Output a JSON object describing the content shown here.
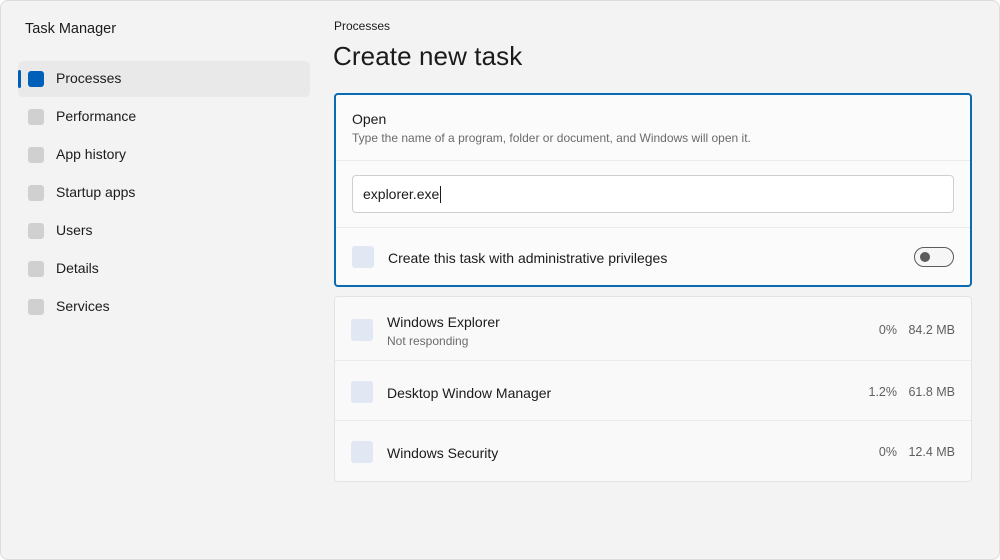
{
  "app": {
    "title": "Task Manager"
  },
  "sidebar": {
    "items": [
      {
        "label": "Processes",
        "icon": "processes-icon",
        "active": true
      },
      {
        "label": "Performance",
        "icon": "performance-icon",
        "active": false
      },
      {
        "label": "App history",
        "icon": "app-history-icon",
        "active": false
      },
      {
        "label": "Startup apps",
        "icon": "startup-apps-icon",
        "active": false
      },
      {
        "label": "Users",
        "icon": "users-icon",
        "active": false
      },
      {
        "label": "Details",
        "icon": "details-icon",
        "active": false
      },
      {
        "label": "Services",
        "icon": "services-icon",
        "active": false
      }
    ]
  },
  "main": {
    "breadcrumb": "Processes",
    "title": "Create new task"
  },
  "dialog": {
    "title": "Open",
    "description": "Type the name of a program, folder or document, and Windows will open it.",
    "input_value": "explorer.exe",
    "admin_label": "Create this task with administrative privileges",
    "admin_toggle_on": false
  },
  "processes": [
    {
      "name": "Windows Explorer",
      "status": "Not responding",
      "cpu": "0%",
      "memory": "84.2 MB"
    },
    {
      "name": "Desktop Window Manager",
      "status": "",
      "cpu": "1.2%",
      "memory": "61.8 MB"
    },
    {
      "name": "Windows Security",
      "status": "",
      "cpu": "0%",
      "memory": "12.4 MB"
    }
  ],
  "colors": {
    "accent": "#005fb8",
    "dialog_border": "#0a6cb0",
    "background": "#f3f3f3"
  }
}
